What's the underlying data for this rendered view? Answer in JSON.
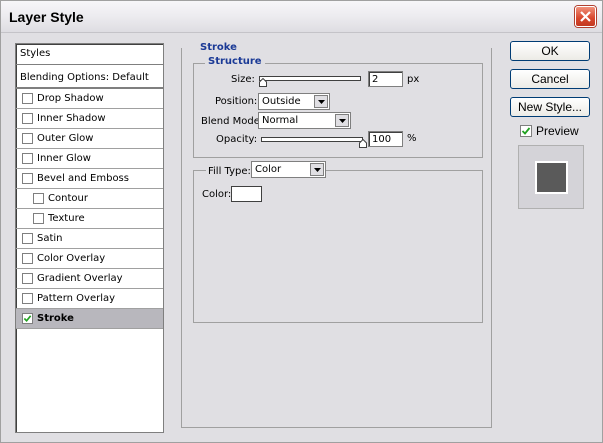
{
  "window": {
    "title": "Layer Style"
  },
  "styles_panel": {
    "header": "Styles",
    "blending_options": "Blending Options: Default",
    "items": [
      {
        "label": "Drop Shadow",
        "checked": false,
        "sub": false,
        "active": false
      },
      {
        "label": "Inner Shadow",
        "checked": false,
        "sub": false,
        "active": false
      },
      {
        "label": "Outer Glow",
        "checked": false,
        "sub": false,
        "active": false
      },
      {
        "label": "Inner Glow",
        "checked": false,
        "sub": false,
        "active": false
      },
      {
        "label": "Bevel and Emboss",
        "checked": false,
        "sub": false,
        "active": false
      },
      {
        "label": "Contour",
        "checked": false,
        "sub": true,
        "active": false
      },
      {
        "label": "Texture",
        "checked": false,
        "sub": true,
        "active": false
      },
      {
        "label": "Satin",
        "checked": false,
        "sub": false,
        "active": false
      },
      {
        "label": "Color Overlay",
        "checked": false,
        "sub": false,
        "active": false
      },
      {
        "label": "Gradient Overlay",
        "checked": false,
        "sub": false,
        "active": false
      },
      {
        "label": "Pattern Overlay",
        "checked": false,
        "sub": false,
        "active": false
      },
      {
        "label": "Stroke",
        "checked": true,
        "sub": false,
        "active": true
      }
    ]
  },
  "stroke": {
    "heading": "Stroke",
    "structure": {
      "heading": "Structure",
      "size_label": "Size:",
      "size_value": "2",
      "size_unit": "px",
      "size_slider_fraction": 0.0,
      "position_label": "Position:",
      "position_value": "Outside",
      "blend_mode_label": "Blend Mode:",
      "blend_mode_value": "Normal",
      "opacity_label": "Opacity:",
      "opacity_value": "100",
      "opacity_unit": "%",
      "opacity_slider_fraction": 1.0
    },
    "fill": {
      "fill_type_label": "Fill Type:",
      "fill_type_value": "Color",
      "color_label": "Color:",
      "color_value": "#FFFFFF"
    }
  },
  "buttons": {
    "ok": "OK",
    "cancel": "Cancel",
    "new_style": "New Style...",
    "preview_label": "Preview",
    "preview_checked": true
  },
  "preview": {
    "swatch_color": "#5A5A5A"
  },
  "colors": {
    "heading_blue": "#1B3A96",
    "close_red": "#D8462C"
  }
}
